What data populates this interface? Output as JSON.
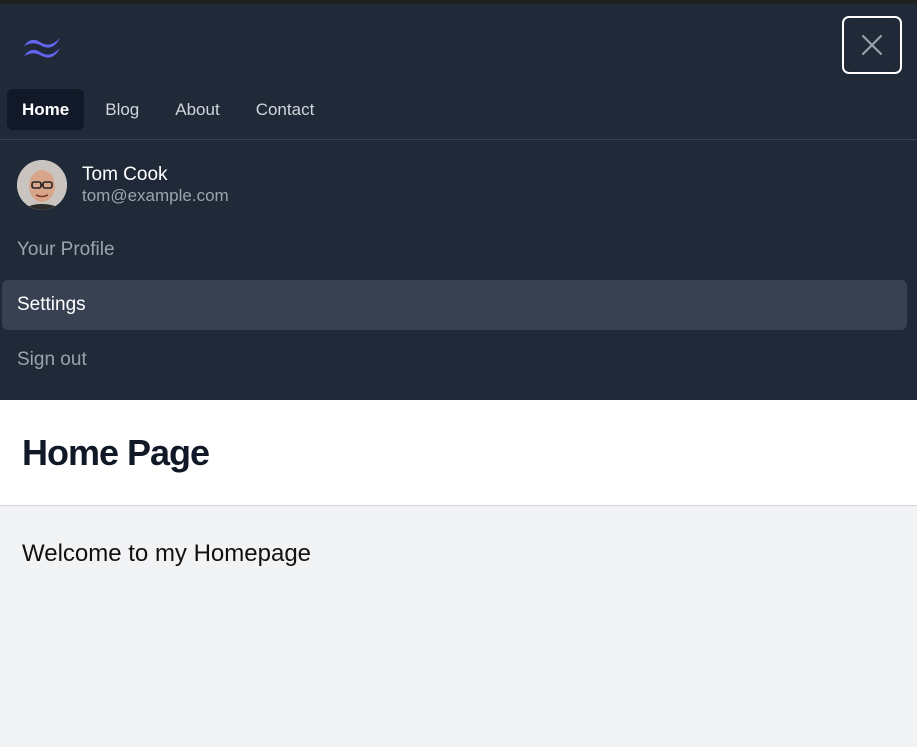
{
  "nav": {
    "logo_icon": "tailwind-logo-icon",
    "close_icon": "close-icon",
    "links": [
      {
        "label": "Home",
        "active": true
      },
      {
        "label": "Blog",
        "active": false
      },
      {
        "label": "About",
        "active": false
      },
      {
        "label": "Contact",
        "active": false
      }
    ]
  },
  "user": {
    "name": "Tom Cook",
    "email": "tom@example.com"
  },
  "menu": {
    "items": [
      {
        "label": "Your Profile",
        "active": false
      },
      {
        "label": "Settings",
        "active": true
      },
      {
        "label": "Sign out",
        "active": false
      }
    ]
  },
  "page": {
    "title": "Home Page",
    "welcome": "Welcome to my Homepage"
  },
  "colors": {
    "nav_bg": "#1f2937",
    "active_link_bg": "#111827",
    "active_menu_bg": "#374151",
    "logo_accent": "#6366f1"
  }
}
